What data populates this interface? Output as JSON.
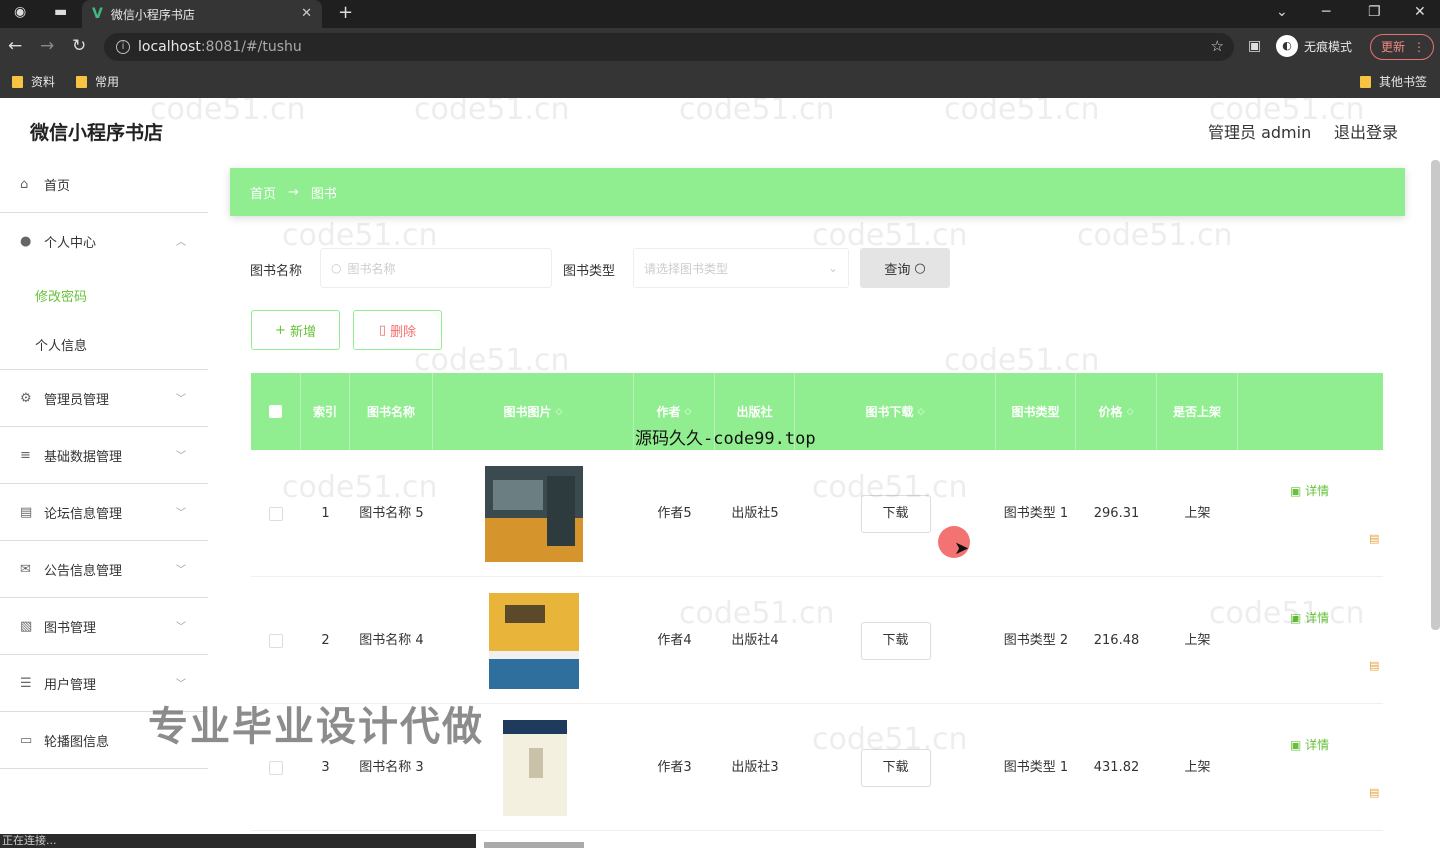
{
  "browser": {
    "tab_title": "微信小程序书店",
    "url_host": "localhost",
    "url_rest": ":8081/#/tushu",
    "incognito_label": "无痕模式",
    "update_label": "更新",
    "bookmarks": [
      "资料",
      "常用"
    ],
    "other_bookmarks": "其他书签",
    "status_text": "正在连接..."
  },
  "app": {
    "title": "微信小程序书店",
    "admin_label": "管理员 admin",
    "logout_label": "退出登录"
  },
  "sidebar": {
    "items": [
      {
        "label": "首页",
        "icon": "home-icon"
      },
      {
        "label": "个人中心",
        "icon": "user-icon"
      },
      {
        "label": "管理员管理",
        "icon": "settings-icon"
      },
      {
        "label": "基础数据管理",
        "icon": "sliders-icon"
      },
      {
        "label": "论坛信息管理",
        "icon": "document-icon"
      },
      {
        "label": "公告信息管理",
        "icon": "announcement-icon"
      },
      {
        "label": "图书管理",
        "icon": "book-icon"
      },
      {
        "label": "用户管理",
        "icon": "list-icon"
      },
      {
        "label": "轮播图信息",
        "icon": "slideshow-icon"
      }
    ],
    "sub_items": [
      "修改密码",
      "个人信息"
    ]
  },
  "breadcrumb": {
    "home": "首页",
    "sep": "→",
    "current": "图书"
  },
  "search": {
    "name_label": "图书名称",
    "name_placeholder": "图书名称",
    "type_label": "图书类型",
    "type_placeholder": "请选择图书类型",
    "query_label": "查询"
  },
  "actions": {
    "add": "新增",
    "delete": "删除"
  },
  "table": {
    "headers": [
      "索引",
      "图书名称",
      "图书图片",
      "作者",
      "出版社",
      "图书下载",
      "图书类型",
      "价格",
      "是否上架"
    ],
    "download_label": "下载",
    "detail_label": "详情",
    "rows": [
      {
        "index": "1",
        "name": "图书名称 5",
        "author": "作者5",
        "publisher": "出版社5",
        "type": "图书类型 1",
        "price": "296.31",
        "status": "上架",
        "cover_color": "#d6952c"
      },
      {
        "index": "2",
        "name": "图书名称 4",
        "author": "作者4",
        "publisher": "出版社4",
        "type": "图书类型 2",
        "price": "216.48",
        "status": "上架",
        "cover_color": "#e8b53a"
      },
      {
        "index": "3",
        "name": "图书名称 3",
        "author": "作者3",
        "publisher": "出版社3",
        "type": "图书类型 1",
        "price": "431.82",
        "status": "上架",
        "cover_color": "#f4f0e0"
      }
    ]
  },
  "overlays": {
    "code_text": "源码久久-code99.top",
    "promo_text": "专业毕业设计代做",
    "watermark": "code51.cn"
  },
  "colors": {
    "accent": "#90ee90",
    "green_text": "#67c23a",
    "danger": "#f56c6c"
  }
}
